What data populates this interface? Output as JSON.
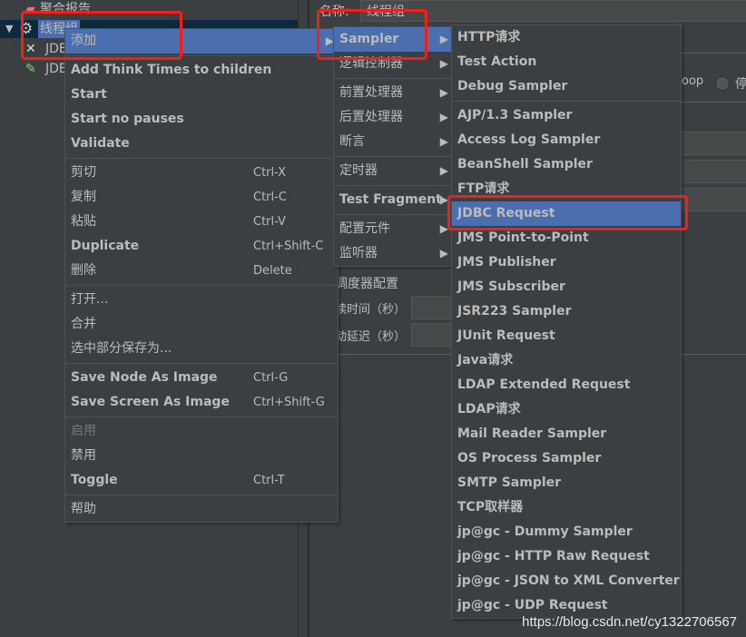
{
  "tree": {
    "items": [
      {
        "label": "聚合报告",
        "icon": "report-icon"
      },
      {
        "label": "线程组",
        "icon": "gear-icon",
        "selected": true
      },
      {
        "label": "JDBC",
        "icon": "tools-icon"
      },
      {
        "label": "JDBC",
        "icon": "pipette-icon"
      }
    ]
  },
  "right_panel": {
    "name_label": "名称:",
    "name_value": "线程组",
    "loop_text": "oop",
    "stop_label": "停",
    "scheduler_title": "调度器配置",
    "duration_label": "续时间（秒）",
    "delay_label": "动延迟（秒）"
  },
  "context_menu": {
    "groups": [
      [
        {
          "label": "添加",
          "submenu": true,
          "highlighted": true,
          "cn": true
        }
      ],
      [
        {
          "label": "Add Think Times to children"
        },
        {
          "label": "Start"
        },
        {
          "label": "Start no pauses"
        },
        {
          "label": "Validate"
        }
      ],
      [
        {
          "label": "剪切",
          "shortcut": "Ctrl-X",
          "cn": true
        },
        {
          "label": "复制",
          "shortcut": "Ctrl-C",
          "cn": true
        },
        {
          "label": "粘贴",
          "shortcut": "Ctrl-V",
          "cn": true
        },
        {
          "label": "Duplicate",
          "shortcut": "Ctrl+Shift-C"
        },
        {
          "label": "删除",
          "shortcut": "Delete",
          "cn": true
        }
      ],
      [
        {
          "label": "打开...",
          "cn": true
        },
        {
          "label": "合并",
          "cn": true
        },
        {
          "label": "选中部分保存为...",
          "cn": true
        }
      ],
      [
        {
          "label": "Save Node As Image",
          "shortcut": "Ctrl-G"
        },
        {
          "label": "Save Screen As Image",
          "shortcut": "Ctrl+Shift-G"
        }
      ],
      [
        {
          "label": "启用",
          "disabled": true
        },
        {
          "label": "禁用",
          "cn": true
        },
        {
          "label": "Toggle",
          "shortcut": "Ctrl-T"
        }
      ],
      [
        {
          "label": "帮助",
          "cn": true
        }
      ]
    ]
  },
  "add_submenu": {
    "groups": [
      [
        {
          "label": "Sampler",
          "submenu": true,
          "highlighted": true
        },
        {
          "label": "逻辑控制器",
          "submenu": true,
          "cn": true
        }
      ],
      [
        {
          "label": "前置处理器",
          "submenu": true,
          "cn": true
        },
        {
          "label": "后置处理器",
          "submenu": true,
          "cn": true
        },
        {
          "label": "断言",
          "submenu": true,
          "cn": true
        }
      ],
      [
        {
          "label": "定时器",
          "submenu": true,
          "cn": true
        }
      ],
      [
        {
          "label": "Test Fragment",
          "submenu": true
        }
      ],
      [
        {
          "label": "配置元件",
          "submenu": true,
          "cn": true
        },
        {
          "label": "监听器",
          "submenu": true,
          "cn": true
        }
      ]
    ]
  },
  "sampler_submenu": {
    "groups": [
      [
        {
          "label": "HTTP请求"
        },
        {
          "label": "Test Action"
        },
        {
          "label": "Debug Sampler"
        }
      ],
      [
        {
          "label": "AJP/1.3 Sampler"
        },
        {
          "label": "Access Log Sampler"
        },
        {
          "label": "BeanShell Sampler"
        },
        {
          "label": "FTP请求"
        },
        {
          "label": "JDBC Request",
          "highlighted": true
        },
        {
          "label": "JMS Point-to-Point"
        },
        {
          "label": "JMS Publisher"
        },
        {
          "label": "JMS Subscriber"
        },
        {
          "label": "JSR223 Sampler"
        },
        {
          "label": "JUnit Request"
        },
        {
          "label": "Java请求"
        },
        {
          "label": "LDAP Extended Request"
        },
        {
          "label": "LDAP请求"
        },
        {
          "label": "Mail Reader Sampler"
        },
        {
          "label": "OS Process Sampler"
        },
        {
          "label": "SMTP Sampler"
        },
        {
          "label": "TCP取样器"
        },
        {
          "label": "jp@gc - Dummy Sampler"
        },
        {
          "label": "jp@gc - HTTP Raw Request"
        },
        {
          "label": "jp@gc - JSON to XML Converter"
        },
        {
          "label": "jp@gc - UDP Request"
        }
      ]
    ]
  },
  "colors": {
    "background": "#3c3f41",
    "highlight": "#4b6eaf",
    "annotation": "#f0201a",
    "text": "#bbbbbb"
  },
  "watermark": "https://blog.csdn.net/cy1322706567"
}
